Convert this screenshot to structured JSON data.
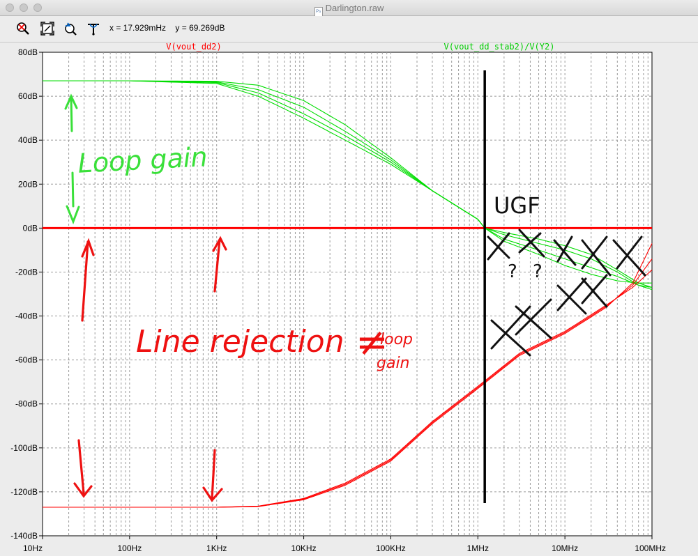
{
  "window": {
    "title": "Darlington.raw"
  },
  "toolbar": {
    "buttons": [
      {
        "icon": "zoom-cancel-icon"
      },
      {
        "icon": "zoom-fit-icon"
      },
      {
        "icon": "undo-zoom-icon"
      },
      {
        "icon": "probe-icon"
      }
    ],
    "x_readout": "x = 17.929mHz",
    "y_readout": "y = 69.269dB"
  },
  "colors": {
    "red": "#ff0000",
    "green": "#00e000",
    "ink": "#000000",
    "plot_bg": "#ffffff",
    "grid": "#a0a0a0"
  },
  "chart_data": {
    "type": "line",
    "x_scale": "log",
    "xlim": [
      10,
      100000000
    ],
    "ylim": [
      -140,
      80
    ],
    "x_ticks": [
      "10Hz",
      "100Hz",
      "1KHz",
      "10KHz",
      "100KHz",
      "1MHz",
      "10MHz",
      "100MHz"
    ],
    "y_ticks": [
      "80dB",
      "60dB",
      "40dB",
      "20dB",
      "0dB",
      "-20dB",
      "-40dB",
      "-60dB",
      "-80dB",
      "-100dB",
      "-120dB",
      "-140dB"
    ],
    "grid": true,
    "trace_labels": {
      "red": "V(vout_dd2)",
      "green": "V(vout_dd_stab2)/V(Y2)"
    },
    "series": [
      {
        "name": "V(vout_dd2)",
        "color": "red",
        "role": "unity reference",
        "x": [
          10,
          100000000
        ],
        "y": [
          0,
          0
        ]
      },
      {
        "name": "V(vout_dd_stab2)/V(Y2)",
        "color": "green",
        "x": [
          10,
          100,
          1000,
          3000,
          10000,
          30000,
          100000,
          300000,
          1000000,
          1200000,
          2000000,
          5000000,
          10000000,
          20000000,
          40000000,
          70000000,
          100000000
        ],
        "y": [
          67,
          67,
          66.8,
          65,
          58,
          47,
          32,
          17,
          4,
          0,
          -6,
          -12,
          -17,
          -21,
          -24,
          -25,
          -25
        ]
      },
      {
        "name": "V(vout_dd_stab2)/V(Y2)",
        "color": "green",
        "x": [
          10,
          100,
          1000,
          3000,
          10000,
          30000,
          100000,
          300000,
          1000000,
          1200000,
          2000000,
          5000000,
          10000000,
          20000000,
          40000000,
          70000000,
          100000000
        ],
        "y": [
          67,
          67,
          66.5,
          63,
          55,
          44,
          31,
          17,
          4,
          0,
          -5,
          -10,
          -14,
          -18,
          -22,
          -26,
          -27
        ]
      },
      {
        "name": "V(vout_dd_stab2)/V(Y2)",
        "color": "green",
        "x": [
          10,
          100,
          1000,
          3000,
          10000,
          30000,
          100000,
          300000,
          1000000,
          1200000,
          2000000,
          5000000,
          10000000,
          20000000,
          40000000,
          70000000,
          100000000
        ],
        "y": [
          67,
          67,
          66.2,
          61.5,
          52,
          42,
          30,
          17,
          4,
          0,
          -3,
          -7,
          -10,
          -14,
          -20,
          -26,
          -28
        ]
      },
      {
        "name": "V(vout_dd_stab2)/V(Y2)",
        "color": "green",
        "x": [
          10,
          100,
          1000,
          3000,
          10000,
          30000,
          100000,
          300000,
          1000000,
          1200000,
          2000000,
          5000000,
          10000000,
          20000000,
          40000000,
          70000000,
          100000000
        ],
        "y": [
          67,
          67,
          65.8,
          60,
          50,
          40,
          29,
          17,
          4,
          0,
          -2,
          -5,
          -8,
          -12,
          -19,
          -25,
          -27
        ]
      },
      {
        "name": "V(vout_dd2)",
        "color": "red",
        "x": [
          10,
          100,
          1000,
          3000,
          10000,
          30000,
          100000,
          300000,
          1000000,
          3000000,
          10000000,
          30000000,
          60000000,
          100000000
        ],
        "y": [
          -127,
          -127,
          -127,
          -126.5,
          -123,
          -116,
          -105,
          -88,
          -72,
          -57,
          -47,
          -35,
          -27,
          -19
        ]
      },
      {
        "name": "V(vout_dd2)",
        "color": "red",
        "x": [
          10,
          100,
          1000,
          3000,
          10000,
          30000,
          100000,
          300000,
          1000000,
          3000000,
          10000000,
          30000000,
          60000000,
          100000000
        ],
        "y": [
          -127,
          -127,
          -127,
          -126.6,
          -123.3,
          -116.5,
          -105.5,
          -88.5,
          -72.5,
          -57.5,
          -47.5,
          -35.5,
          -26,
          -14
        ]
      },
      {
        "name": "V(vout_dd2)",
        "color": "red",
        "x": [
          10,
          100,
          1000,
          3000,
          10000,
          30000,
          100000,
          300000,
          1000000,
          3000000,
          10000000,
          30000000,
          60000000,
          100000000
        ],
        "y": [
          -127,
          -127,
          -127,
          -126.7,
          -123.6,
          -117,
          -106,
          -89,
          -73,
          -58,
          -48,
          -36,
          -25,
          -7
        ]
      }
    ],
    "annotations": [
      {
        "text": "Loop gain",
        "color": "green"
      },
      {
        "text": "UGF",
        "color": "ink"
      },
      {
        "text": "Line rejection",
        "color": "red"
      },
      {
        "text": "≠",
        "color": "red"
      },
      {
        "text": "loop",
        "color": "red"
      },
      {
        "text": "gain",
        "color": "red"
      },
      {
        "text": "?",
        "color": "ink"
      },
      {
        "text": "?",
        "color": "ink"
      }
    ],
    "ugf_marker_x": 1200000
  }
}
